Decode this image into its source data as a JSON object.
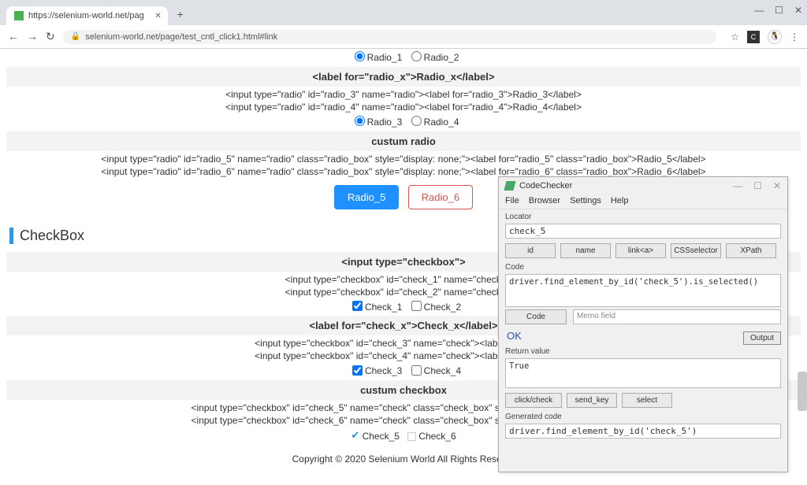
{
  "browser": {
    "tab_title": "https://selenium-world.net/pag",
    "url_display": "selenium-world.net/page/test_cntl_click1.html#link"
  },
  "radio": {
    "r1": "Radio_1",
    "r2": "Radio_2",
    "label_head": "<label for=\"radio_x\">Radio_x</label>",
    "code1": "<input type=\"radio\" id=\"radio_3\" name=\"radio\"><label for=\"radio_3\">Radio_3</label>",
    "code2": "<input type=\"radio\" id=\"radio_4\" name=\"radio\"><label for=\"radio_4\">Radio_4</label>",
    "r3": "Radio_3",
    "r4": "Radio_4",
    "custom_head": "custum radio",
    "code3": "<input type=\"radio\" id=\"radio_5\" name=\"radio\" class=\"radio_box\" style=\"display: none;\"><label for=\"radio_5\" class=\"radio_box\">Radio_5</label>",
    "code4": "<input type=\"radio\" id=\"radio_6\" name=\"radio\" class=\"radio_box\" style=\"display: none;\"><label for=\"radio_6\" class=\"radio_box\">Radio_6</label>",
    "r5": "Radio_5",
    "r6": "Radio_6"
  },
  "checkbox_heading": "CheckBox",
  "checkbox": {
    "head1": "<input type=\"checkbox\">",
    "code1": "<input type=\"checkbox\" id=\"check_1\" name=\"check\">Ch",
    "code2": "<input type=\"checkbox\" id=\"check_2\" name=\"check\">Ch",
    "c1": "Check_1",
    "c2": "Check_2",
    "head2": "<label for=\"check_x\">Check_x</label>",
    "code3": "<input type=\"checkbox\" id=\"check_3\" name=\"check\"><label for=\"check",
    "code4": "<input type=\"checkbox\" id=\"check_4\" name=\"check\"><label for=\"check",
    "c3": "Check_3",
    "c4": "Check_4",
    "head3": "custum checkbox",
    "code5": "<input type=\"checkbox\" id=\"check_5\" name=\"check\" class=\"check_box\" style=\"display: none;\"><label",
    "code6": "<input type=\"checkbox\" id=\"check_6\" name=\"check\" class=\"check_box\" style=\"display: none;\"><label",
    "c5": "Check_5",
    "c6": "Check_6"
  },
  "footer": "Copyright © 2020 Selenium World All Rights Reserve",
  "cc": {
    "title": "CodeChecker",
    "menu": {
      "file": "File",
      "browser": "Browser",
      "settings": "Settings",
      "help": "Help"
    },
    "locator_label": "Locator",
    "locator_value": "check_5",
    "btn_id": "id",
    "btn_name": "name",
    "btn_link": "link<a>",
    "btn_css": "CSSselector",
    "btn_xpath": "XPath",
    "code_label": "Code",
    "code_value": "driver.find_element_by_id('check_5').is_selected()",
    "btn_code": "Code",
    "memo_placeholder": "Memo field",
    "ok": "OK",
    "btn_output": "Output",
    "return_label": "Return value",
    "return_value": "True",
    "btn_click": "click/check",
    "btn_send": "send_key",
    "btn_select": "select",
    "gen_label": "Generated code",
    "gen_value": "driver.find_element_by_id('check_5')"
  }
}
